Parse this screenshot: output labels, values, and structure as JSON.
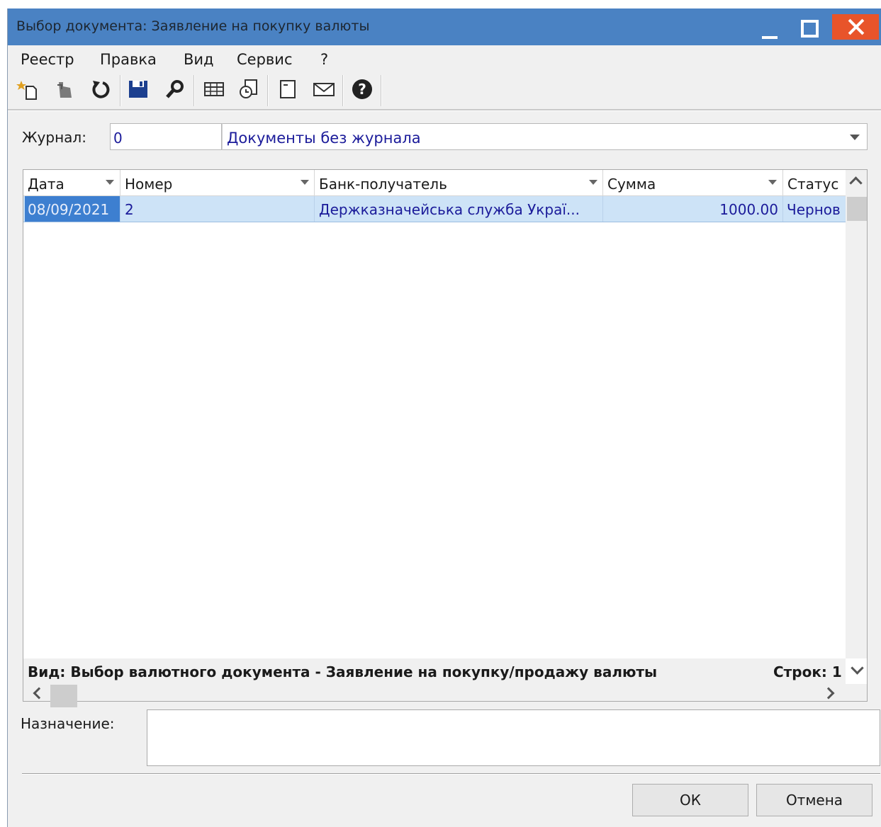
{
  "window": {
    "title": "Выбор документа: Заявление на покупку валюты"
  },
  "menu": [
    "Реестр",
    "Правка",
    "Вид",
    "Сервис",
    "?"
  ],
  "toolbar": {
    "icons": [
      "new-doc-icon",
      "hand-icon",
      "refresh-icon",
      "save-icon",
      "search-icon",
      "table-icon",
      "copy-icon",
      "form-icon",
      "mail-icon",
      "help-icon"
    ]
  },
  "journal": {
    "label": "Журнал:",
    "number": "0",
    "name": "Документы без журнала"
  },
  "grid": {
    "columns": [
      "Дата",
      "Номер",
      "Банк-получатель",
      "Сумма",
      "Статус"
    ],
    "rows": [
      [
        "08/09/2021",
        "2",
        "Держказначейська служба Украї...",
        "1000.00",
        "Чернов"
      ]
    ],
    "status_left": "Вид: Выбор валютного документа - Заявление на покупку/продажу валюты",
    "status_right": "Строк: 1"
  },
  "purpose": {
    "label": "Назначение:",
    "value": ""
  },
  "buttons": {
    "ok": "ОК",
    "cancel": "Отмена"
  },
  "colors": {
    "titlebar": "#4a82c3",
    "close": "#e8542a",
    "selection": "#cde3f7",
    "selected_cell": "#3d7fd0",
    "link_text": "#1b1b9a"
  }
}
